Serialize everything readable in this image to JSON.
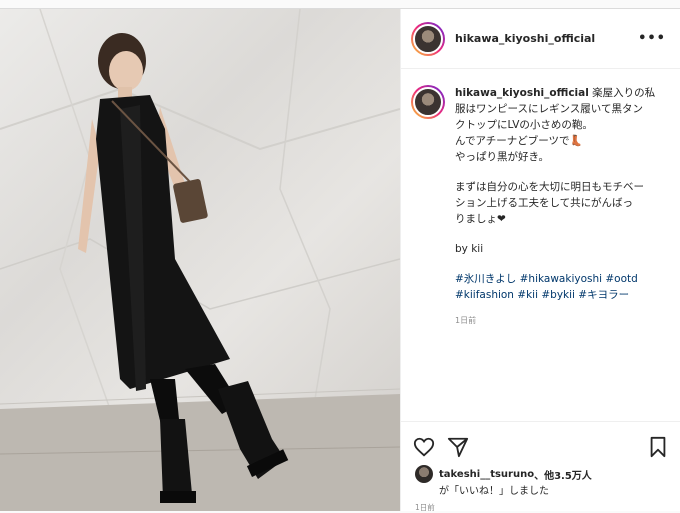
{
  "post": {
    "username": "hikawa_kiyoshi_official",
    "more_icon": "•••",
    "caption": {
      "username": "hikawa_kiyoshi_official",
      "lines": [
        " 楽屋入りの私",
        "服はワンピースにレギンス履いて黒タン",
        "クトップにLVの小さめの鞄。",
        "んでアチーナどブーツで👢",
        "やっぱり黒が好き。"
      ],
      "para2": [
        "まずは自分の心を大切に明日もモチベー",
        "ション上げる工夫をして共にがんばっ",
        "りましょ❤"
      ],
      "by": "by kii",
      "hashtags_line1": "#氷川きよし #hikawakiyoshi #ootd",
      "hashtags_line2": "#kiifashion #kii #bykii #キヨラー",
      "age": "1日前"
    },
    "likes": {
      "liker": "takeshi__tsuruno",
      "rest": "、他3.5万人",
      "line2": "が「いいね！」しました"
    },
    "date": "1日前"
  },
  "icons": {
    "like": "heart-icon",
    "share": "paper-plane-icon",
    "save": "bookmark-icon",
    "more": "more-options-icon"
  }
}
